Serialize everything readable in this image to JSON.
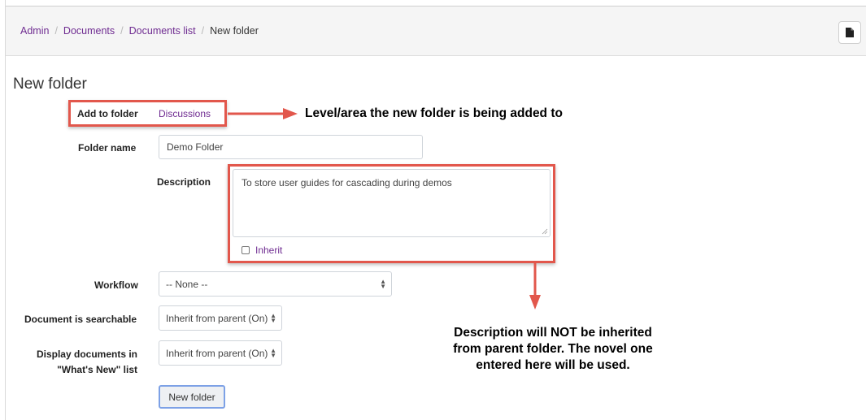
{
  "breadcrumb": {
    "items": [
      {
        "label": "Admin"
      },
      {
        "label": "Documents"
      },
      {
        "label": "Documents list"
      }
    ],
    "separator": "/",
    "current": "New folder"
  },
  "toolbar": {
    "document_icon": "document-icon"
  },
  "page": {
    "title": "New folder"
  },
  "form": {
    "add_to_folder_label": "Add to folder",
    "add_to_folder_value": "Discussions",
    "folder_name_label": "Folder name",
    "folder_name_value": "Demo Folder",
    "description_label": "Description",
    "description_value": "To store user guides for cascading during demos",
    "inherit_label": "Inherit",
    "inherit_checked": false,
    "workflow_label": "Workflow",
    "workflow_value": "-- None --",
    "searchable_label": "Document is searchable",
    "searchable_value": "Inherit from parent (On)",
    "display_label_line1": "Display documents in",
    "display_label_line2": "\"What's New\" list",
    "display_value": "Inherit from parent (On)",
    "submit_label": "New folder"
  },
  "annotations": {
    "top": "Level/area the new folder is being added to",
    "bottom_line1": "Description will NOT be inherited",
    "bottom_line2": "from parent folder. The novel one",
    "bottom_line3": "entered here will be used."
  },
  "colors": {
    "link": "#6f2c91",
    "highlight": "#e2574c",
    "breadcrumb_bg": "#f5f5f5"
  }
}
